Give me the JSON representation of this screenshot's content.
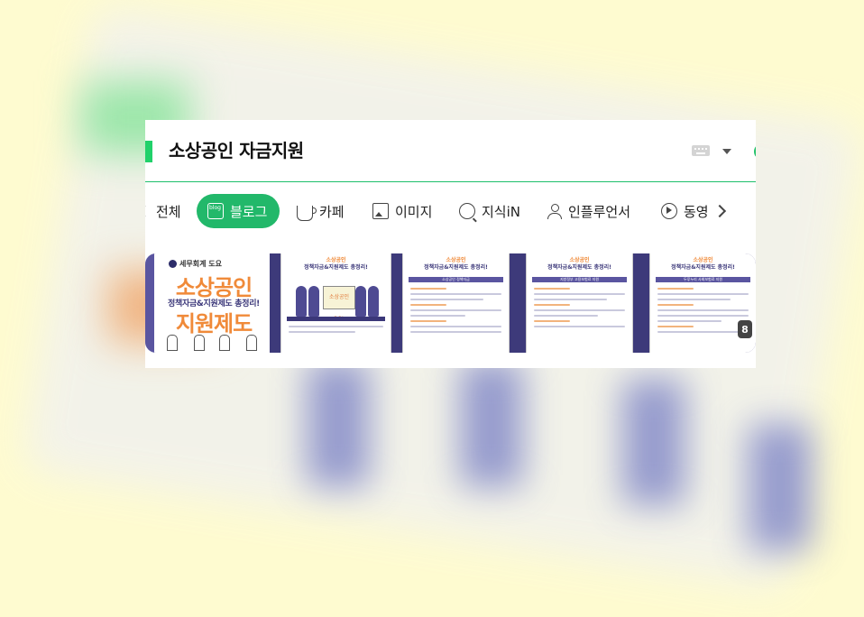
{
  "search": {
    "query": "소상공인 자금지원"
  },
  "tabs": [
    {
      "label": "전체"
    },
    {
      "label": "블로그"
    },
    {
      "label": "카페"
    },
    {
      "label": "이미지"
    },
    {
      "label": "지식iN"
    },
    {
      "label": "인플루언서"
    },
    {
      "label": "동영"
    }
  ],
  "thumbnail_1": {
    "brand": "세무회계 도요",
    "title_top": "소상공인",
    "subtitle": "정책자금&지원제도 총정리!",
    "title_bottom": "지원제도"
  },
  "slide_header": {
    "line1": "소상공인",
    "line2": "정책자금&지원제도 총정리!"
  },
  "slides": [
    {
      "sign": "소상공인 OOL"
    },
    {
      "band": "소상공인 정책자금"
    },
    {
      "band": "지방정부 고용보험료 지원"
    },
    {
      "band": "두루누리 사회보험료 지원"
    }
  ],
  "gallery": {
    "more_count": "8"
  },
  "colors": {
    "accent": "#22b86a",
    "brand_orange": "#f08a39",
    "brand_purple": "#3b3779"
  }
}
